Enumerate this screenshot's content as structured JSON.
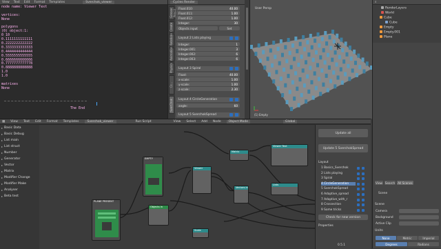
{
  "text_editor": {
    "menu": [
      "View",
      "Text",
      "Edit",
      "Format",
      "Templates"
    ],
    "file_name": "Sverchok_viewer",
    "lines": [
      "node name: Viewer Text",
      "",
      "vertices:",
      "None",
      "",
      "polygons",
      "(0) object:1:",
      "  0  10",
      "0.1111111111111",
      "0.2222222222222",
      "0.3333333333333",
      "0.4444444444444",
      "0.5555555555555",
      "0.6666666666666",
      "0.7777777777778",
      "0.8888888888888",
      "1.0",
      "1.0",
      "",
      "matrixes",
      "None",
      "",
      "",
      "",
      "",
      "The End"
    ],
    "footer_menu": [
      "View",
      "Text",
      "Edit",
      "Format",
      "Templates"
    ],
    "footer_file": "Sverchok_viewer",
    "run_script": "Run Script"
  },
  "sv_panel": {
    "header": "Cycles Render",
    "tabs": [
      "Grease Pencil",
      "Create",
      "Relations",
      "Animation",
      "Physics",
      "Cr...",
      "SverChok"
    ],
    "fields_top": [
      {
        "label": "Float.010:",
        "value": "40.00"
      },
      {
        "label": "Float.011:",
        "value": "1.00"
      },
      {
        "label": "Float.012:",
        "value": "1.00"
      },
      {
        "label": "Integer:",
        "value": "30"
      }
    ],
    "objects_input": "Objects input",
    "objects_set": "Set",
    "layouts": [
      {
        "title": "Layout 2 Lists playing",
        "fields": [
          {
            "label": "Integer:",
            "value": "1"
          },
          {
            "label": "Integer.001:",
            "value": "3"
          },
          {
            "label": "Integer.002:",
            "value": "6"
          },
          {
            "label": "Integer.003:",
            "value": "6"
          }
        ]
      },
      {
        "title": "Layout 3 Spiral",
        "fields": [
          {
            "label": "Float:",
            "value": "40.00"
          },
          {
            "label": "x-scale:",
            "value": "1.00"
          },
          {
            "label": "y-scale:",
            "value": "1.00"
          },
          {
            "label": "z-scale:",
            "value": "2.30"
          }
        ]
      },
      {
        "title": "Layout 4 CircleGeneration",
        "fields": [
          {
            "label": "angle:",
            "value": "60"
          }
        ]
      }
    ],
    "layout5": "Layout 5 SverchokSpread"
  },
  "viewport": {
    "label": "User Persp",
    "footer": "(1) Empty"
  },
  "outliner": {
    "items": [
      "RenderLayers",
      "World",
      "Cube",
      "Cube",
      "Empty",
      "Empty.001",
      "Plane"
    ]
  },
  "node_editor": {
    "categories": [
      "Basic Data",
      "Basic Debug",
      "List main",
      "List struct",
      "Number",
      "Generator",
      "Vector",
      "Matrix",
      "Modifier Change",
      "Modifier Make",
      "Analyser",
      "Beta test"
    ],
    "header_menu": [
      "View",
      "Select",
      "Add",
      "Node"
    ],
    "mode": "Object Mode",
    "global": "Global",
    "nodes": {
      "plane": "PLANE PRESENT",
      "empty": "EMPTY",
      "n1": "Objects in",
      "n2": "Viewer",
      "n3": "Vectors in",
      "n4": "Matrix",
      "n5": "Viewer Text",
      "n6": "Lists",
      "n7": "Scale"
    }
  },
  "sv_update": {
    "update_all": "Update all",
    "update_one": "Update 5 SverchokSpread",
    "layout_header": "Layout",
    "layouts": [
      "1 Basics_Sverchok",
      "2 Lists playing",
      "3 Spiral",
      "4 CircleGeneration",
      "5 SverchokSpread",
      "6 Adaptive_spread",
      "7 Adaptive_with_r",
      "8 Crossection",
      "9 Some tricks"
    ],
    "selected_index": 3,
    "check": "Check for new version",
    "properties": "Properties",
    "footer": "0.5.1"
  },
  "properties": {
    "tabs": [
      "View",
      "Search",
      "All Scenes"
    ],
    "scene_label": "Scene",
    "scene_header": "Scene",
    "rows": [
      "Camera",
      "Background",
      "Active Clip"
    ],
    "units_header": "Units",
    "unit_buttons": [
      "None",
      "Metric",
      "Imperial"
    ],
    "angle_buttons": [
      "Degrees",
      "Radians"
    ]
  },
  "colors": {
    "accent": "#5a7fb0",
    "node_green": "#2f8c4a",
    "node_teal": "#2d8b8b",
    "text_pink": "#ffb3f0"
  }
}
